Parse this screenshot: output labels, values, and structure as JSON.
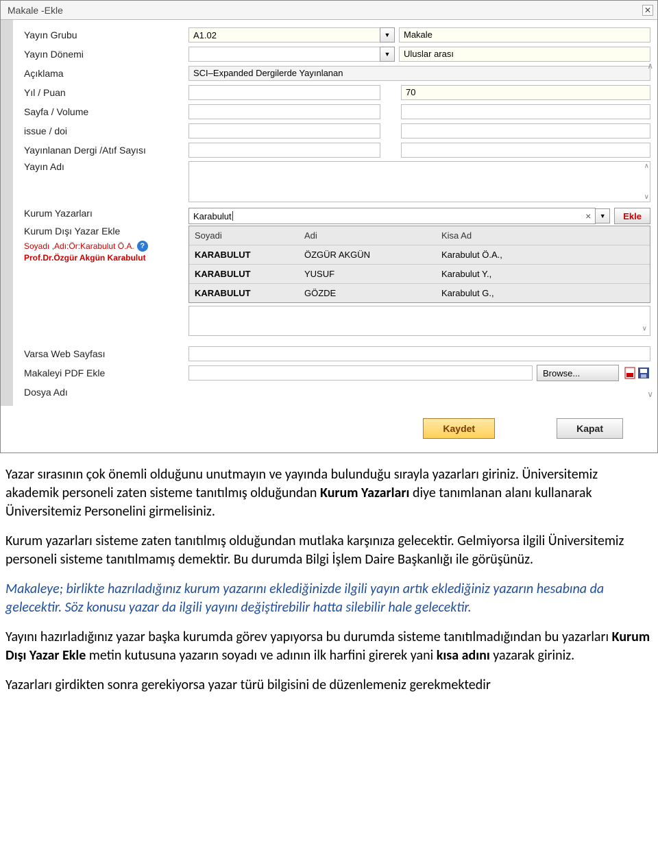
{
  "dialog": {
    "title": "Makale -Ekle",
    "labels": {
      "yayin_grubu": "Yayın Grubu",
      "yayin_donemi": "Yayın Dönemi",
      "aciklama": "Açıklama",
      "yil_puan": "Yıl / Puan",
      "sayfa_volume": "Sayfa / Volume",
      "issue_doi": "issue / doi",
      "dergi_atif": "Yayınlanan Dergi /Atıf Sayısı",
      "yayin_adi": "Yayın Adı",
      "kurum_yazarlari": "Kurum Yazarları",
      "kurum_disi": "Kurum Dışı Yazar Ekle",
      "web_sayfasi": "Varsa Web Sayfası",
      "pdf_ekle": "Makaleyi PDF Ekle",
      "dosya_adi": "Dosya Adı"
    },
    "values": {
      "yayin_grubu_code": "A1.02",
      "yayin_grubu_name": "Makale",
      "yayin_donemi": "",
      "yayin_donemi_extra": "Uluslar arası",
      "aciklama": "SCI–Expanded Dergilerde Yayınlanan",
      "puan": "70",
      "author_search": "Karabulut"
    },
    "hints": {
      "example": "Soyadı ,Adı:Ör:Karabulut Ö.A.",
      "selected": "Prof.Dr.Özgür Akgün Karabulut"
    },
    "suggest": {
      "head": {
        "c1": "Soyadi",
        "c2": "Adi",
        "c3": "Kisa Ad"
      },
      "rows": [
        {
          "c1": "KARABULUT",
          "c2": "ÖZGÜR AKGÜN",
          "c3": "Karabulut Ö.A.,"
        },
        {
          "c1": "KARABULUT",
          "c2": "YUSUF",
          "c3": "Karabulut Y.,"
        },
        {
          "c1": "KARABULUT",
          "c2": "GÖZDE",
          "c3": "Karabulut G.,"
        }
      ]
    },
    "buttons": {
      "ekle": "Ekle",
      "browse": "Browse...",
      "kaydet": "Kaydet",
      "kapat": "Kapat"
    }
  },
  "instructions": {
    "p1a": "Yazar sırasının  çok önemli olduğunu unutmayın ve yayında bulunduğu sırayla yazarları giriniz. Üniversitemiz akademik personeli zaten sisteme tanıtılmış olduğundan ",
    "p1b": "Kurum Yazarları",
    "p1c": " diye tanımlanan alanı kullanarak Üniversitemiz Personelini girmelisiniz.",
    "p2": "Kurum yazarları sisteme zaten tanıtılmış olduğundan mutlaka karşınıza gelecektir. Gelmiyorsa ilgili Üniversitemiz personeli sisteme tanıtılmamış demektir. Bu durumda Bilgi İşlem Daire Başkanlığı ile görüşünüz.",
    "p3": "Makaleye; birlikte hazrıladığınız  kurum yazarını eklediğinizde ilgili yayın artık eklediğiniz yazarın hesabına da gelecektir. Söz konusu yazar da ilgili yayını değiştirebilir hatta silebilir hale gelecektir.",
    "p4a": "Yayını hazırladığınız yazar  başka kurumda görev yapıyorsa  bu durumda sisteme tanıtılmadığından bu yazarları ",
    "p4b": "Kurum Dışı Yazar Ekle",
    "p4c": " metin kutusuna yazarın soyadı ve adının ilk harfini girerek yani ",
    "p4d": "kısa adını",
    "p4e": " yazarak giriniz.",
    "p5": "Yazarları girdikten sonra gerekiyorsa yazar türü bilgisini de düzenlemeniz gerekmektedir"
  }
}
